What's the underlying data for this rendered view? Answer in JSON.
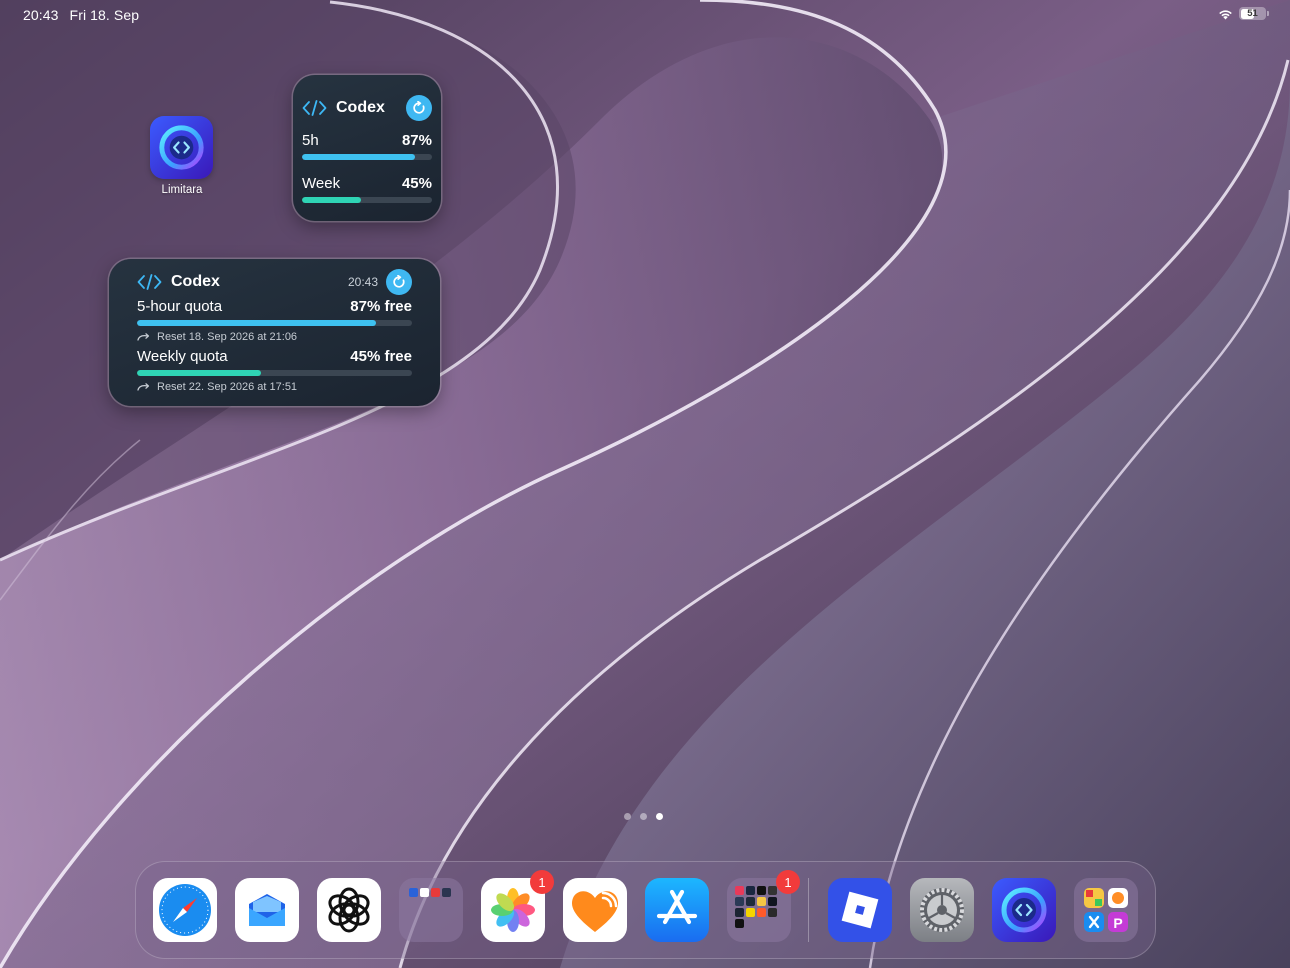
{
  "status_bar": {
    "time": "20:43",
    "date": "Fri 18. Sep",
    "battery": "51",
    "wifi_icon": "wifi-icon"
  },
  "home_apps": [
    {
      "label": "Limitara",
      "icon": "limitara-icon"
    }
  ],
  "widget_small": {
    "title": "Codex",
    "rows": [
      {
        "label": "5h",
        "value": "87%",
        "progress": 0.87,
        "color": "#3ec1f0"
      },
      {
        "label": "Week",
        "value": "45%",
        "progress": 0.45,
        "color": "#2fd4b5"
      }
    ]
  },
  "widget_medium": {
    "title": "Codex",
    "time": "20:43",
    "rows": [
      {
        "label": "5-hour quota",
        "value": "87% free",
        "progress": 0.87,
        "reset": "Reset 18. Sep 2026 at 21:06",
        "color": "#3ec1f0"
      },
      {
        "label": "Weekly quota",
        "value": "45% free",
        "progress": 0.45,
        "reset": "Reset 22. Sep 2026 at 17:51",
        "color": "#2fd4b5"
      }
    ]
  },
  "page_dots": {
    "count": 3,
    "active": 3
  },
  "dock": {
    "apps": [
      {
        "icon": "safari-icon"
      },
      {
        "icon": "mail-stack-icon"
      },
      {
        "icon": "chatgpt-icon"
      },
      {
        "icon": "folder-icon"
      },
      {
        "icon": "photos-icon",
        "badge": "1"
      },
      {
        "icon": "health-heart-icon"
      },
      {
        "icon": "app-store-icon"
      },
      {
        "icon": "folder-apps-icon",
        "badge": "1"
      },
      {
        "icon": "roblox-icon"
      },
      {
        "icon": "settings-icon"
      },
      {
        "icon": "limitara-icon"
      },
      {
        "icon": "app-library-icon"
      }
    ]
  }
}
